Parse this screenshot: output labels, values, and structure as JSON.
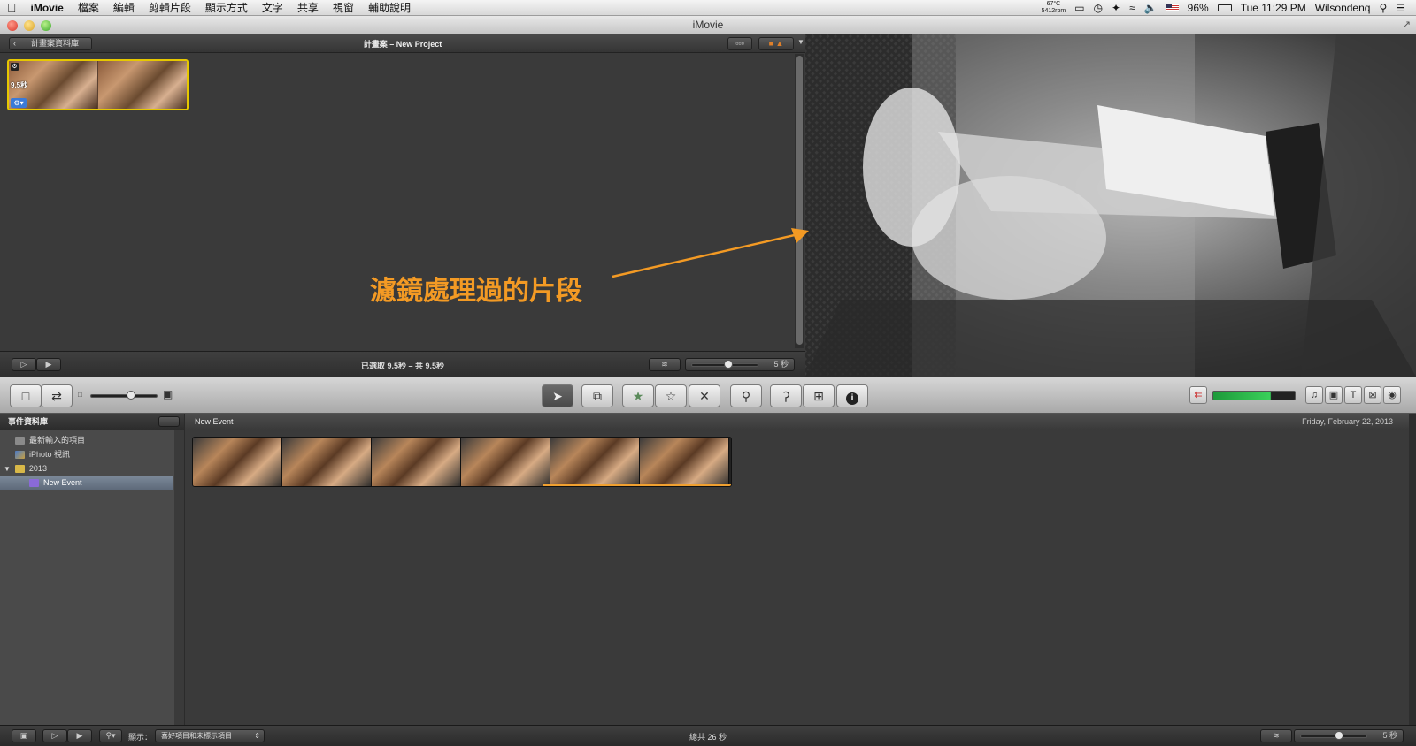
{
  "menubar": {
    "apple": "",
    "app": "iMovie",
    "items": [
      "檔案",
      "編輯",
      "剪輯片段",
      "顯示方式",
      "文字",
      "共享",
      "視窗",
      "輔助說明"
    ],
    "temp": "67°C",
    "rpm": "5412rpm",
    "battery": "96%",
    "clock": "Tue 11:29 PM",
    "user": "Wilsondenq"
  },
  "window": {
    "title": "iMovie"
  },
  "project": {
    "back_label": "計畫案資料庫",
    "title": "計畫案 – New Project",
    "clip_duration": "9.5秒",
    "status": "已選取 9.5秒 – 共 9.5秒",
    "zoom_label": "5 秒",
    "zoom_level": 0.55
  },
  "viewer": {
    "annotation": "濾鏡處理過的片段"
  },
  "toolbar": {
    "select_icon": "arrow-icon",
    "favorite_icon": "star-filled-icon",
    "unmark_icon": "star-outline-icon",
    "reject_icon": "x-icon",
    "keyword_icon": "key-icon",
    "voiceover_icon": "mic-icon",
    "crop_icon": "crop-icon",
    "info_icon": "info-icon",
    "thumb_size_level": 0.6
  },
  "library": {
    "header": "事件資料庫",
    "items": [
      {
        "label": "最新輸入的項目"
      },
      {
        "label": "iPhoto 視訊"
      },
      {
        "label": "2013"
      },
      {
        "label": "New Event"
      }
    ]
  },
  "events": {
    "name": "New Event",
    "date": "Friday, February 22, 2013"
  },
  "bottom": {
    "filter_label": "顯示：",
    "filter_value": "喜好項目和未標示項目",
    "status": "總共 26 秒",
    "zoom_label": "5 秒"
  },
  "colors": {
    "annotation": "#f39a24",
    "selection": "#e6c800",
    "favorite_bar": "#f0a030",
    "vu_meter": "#3ad05a"
  }
}
